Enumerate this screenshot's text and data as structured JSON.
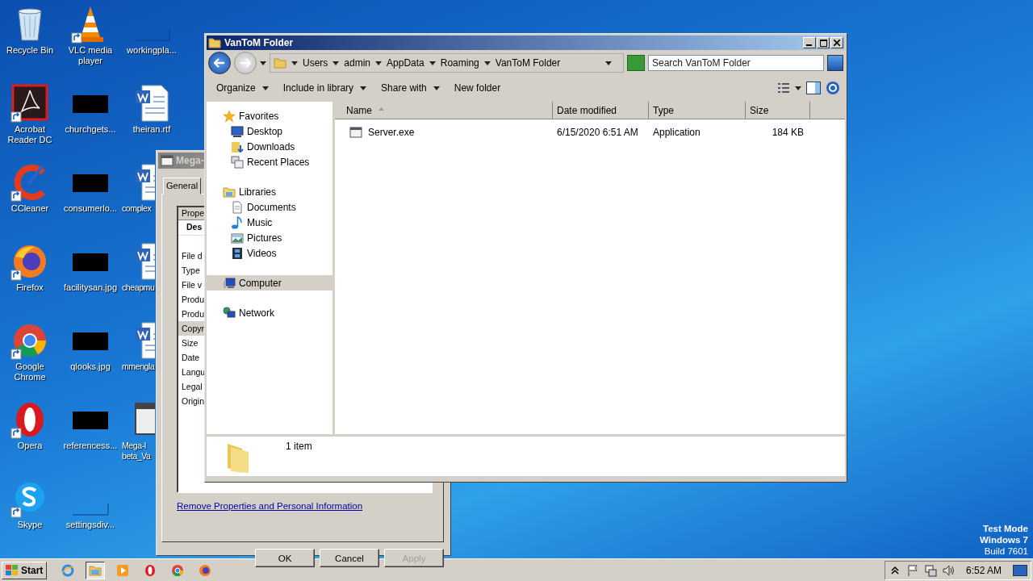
{
  "desktop": {
    "icons": [
      {
        "label": "Recycle Bin",
        "kind": "recycle",
        "shortcut": false
      },
      {
        "label": "Acrobat Reader DC",
        "kind": "acrobat",
        "shortcut": true
      },
      {
        "label": "CCleaner",
        "kind": "ccleaner",
        "shortcut": true
      },
      {
        "label": "Firefox",
        "kind": "firefox",
        "shortcut": true
      },
      {
        "label": "Google Chrome",
        "kind": "chrome",
        "shortcut": true
      },
      {
        "label": "Opera",
        "kind": "opera",
        "shortcut": true
      },
      {
        "label": "Skype",
        "kind": "skype",
        "shortcut": true
      },
      {
        "label": "VLC media player",
        "kind": "vlc",
        "shortcut": true
      },
      {
        "label": "churchgets...",
        "kind": "thumb",
        "shortcut": false
      },
      {
        "label": "consumerlo...",
        "kind": "thumb",
        "shortcut": false
      },
      {
        "label": "facilitysan.jpg",
        "kind": "thumb",
        "shortcut": false
      },
      {
        "label": "qlooks.jpg",
        "kind": "thumb",
        "shortcut": false
      },
      {
        "label": "referencess...",
        "kind": "thumb",
        "shortcut": false
      },
      {
        "label": "settingsdiv...",
        "kind": "blank",
        "shortcut": false
      },
      {
        "label": "workingpla...",
        "kind": "blank",
        "shortcut": false
      },
      {
        "label": "theiran.rtf",
        "kind": "word",
        "shortcut": false
      },
      {
        "label": "complex",
        "kind": "word",
        "shortcut": false
      },
      {
        "label": "cheapmu",
        "kind": "word",
        "shortcut": false
      },
      {
        "label": "mmengla",
        "kind": "word",
        "shortcut": false
      },
      {
        "label": "Mega-l\nbeta_Va",
        "kind": "window",
        "shortcut": false
      }
    ]
  },
  "properties_dialog": {
    "title": "Mega-",
    "tabs": [
      {
        "label": "General",
        "selected": true
      }
    ],
    "list_header": "Prope",
    "group": "Des",
    "rows": [
      {
        "label": "File d",
        "selected": false
      },
      {
        "label": "Type",
        "selected": false
      },
      {
        "label": "File v",
        "selected": false
      },
      {
        "label": "Produ",
        "selected": false
      },
      {
        "label": "Produ",
        "selected": false
      },
      {
        "label": "Copyr",
        "selected": true
      },
      {
        "label": "Size",
        "selected": false
      },
      {
        "label": "Date",
        "selected": false
      },
      {
        "label": "Langu",
        "selected": false
      },
      {
        "label": "Legal",
        "selected": false
      },
      {
        "label": "Origin",
        "selected": false
      }
    ],
    "link": "Remove Properties and Personal Information",
    "buttons": [
      {
        "label": "OK",
        "disabled": false
      },
      {
        "label": "Cancel",
        "disabled": false
      },
      {
        "label": "Apply",
        "disabled": true
      }
    ]
  },
  "explorer": {
    "title": "VanToM Folder",
    "path": [
      "Users",
      "admin",
      "AppData",
      "Roaming",
      "VanToM Folder"
    ],
    "search": {
      "placeholder": "Search VanToM Folder"
    },
    "toolbar": [
      {
        "label": "Organize",
        "dropdown": true
      },
      {
        "label": "Include in library",
        "dropdown": true
      },
      {
        "label": "Share with",
        "dropdown": true
      },
      {
        "label": "New folder",
        "dropdown": false
      }
    ],
    "nav": [
      {
        "label": "Favorites",
        "kind": "star",
        "selected": false,
        "children": [
          {
            "label": "Desktop",
            "kind": "desktop",
            "selected": false
          },
          {
            "label": "Downloads",
            "kind": "downloads",
            "selected": false
          },
          {
            "label": "Recent Places",
            "kind": "recent",
            "selected": false
          }
        ]
      },
      {
        "label": "Libraries",
        "kind": "library",
        "selected": false,
        "children": [
          {
            "label": "Documents",
            "kind": "document",
            "selected": false
          },
          {
            "label": "Music",
            "kind": "music",
            "selected": false
          },
          {
            "label": "Pictures",
            "kind": "pictures",
            "selected": false
          },
          {
            "label": "Videos",
            "kind": "videos",
            "selected": false
          }
        ]
      },
      {
        "label": "Computer",
        "kind": "computer",
        "selected": true
      },
      {
        "label": "Network",
        "kind": "network",
        "selected": false
      }
    ],
    "columns": [
      {
        "label": "Name",
        "sorted": true
      },
      {
        "label": "Date modified",
        "sorted": false
      },
      {
        "label": "Type",
        "sorted": false
      },
      {
        "label": "Size",
        "sorted": false
      }
    ],
    "rows": [
      {
        "name": "Server.exe",
        "date": "6/15/2020 6:51 AM",
        "type": "Application",
        "size": "184 KB",
        "selected": false
      }
    ],
    "status": "1 item"
  },
  "watermark": [
    "Test Mode",
    "Windows 7",
    "Build 7601"
  ],
  "taskbar": {
    "start": "Start",
    "apps": [
      {
        "kind": "ie",
        "active": false
      },
      {
        "kind": "explorer",
        "active": true
      },
      {
        "kind": "media",
        "active": false
      },
      {
        "kind": "opera",
        "active": false
      },
      {
        "kind": "chrome",
        "active": false
      },
      {
        "kind": "firefox",
        "active": false
      }
    ],
    "clock": "6:52 AM"
  }
}
